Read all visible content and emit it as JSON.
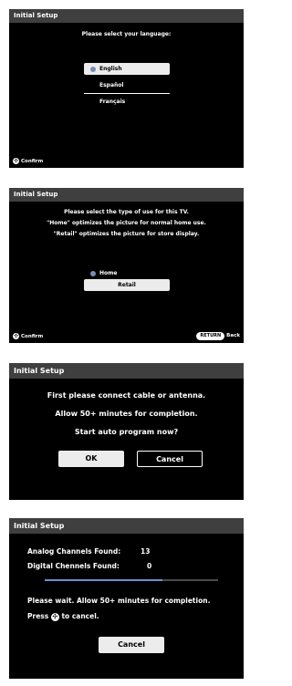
{
  "screen1": {
    "title": "Initial Setup",
    "prompt": "Please select your language:",
    "options": [
      {
        "label": "English",
        "selected": true
      },
      {
        "label": "Español",
        "selected": false
      },
      {
        "label": "Français",
        "selected": false
      }
    ],
    "confirm_label": "Confirm"
  },
  "screen2": {
    "title": "Initial Setup",
    "lines": [
      "Please select the type of use for this TV.",
      "\"Home\" optimizes the picture for normal home use.",
      "\"Retail\" optimizes the picture for store display."
    ],
    "options": [
      {
        "label": "Home",
        "selected": false
      },
      {
        "label": "Retail",
        "selected": true
      }
    ],
    "confirm_label": "Confirm",
    "return_key": "RETURN",
    "back_label": "Back"
  },
  "screen3": {
    "title": "Initial Setup",
    "lines": [
      "First please connect cable or antenna.",
      "Allow 50+ minutes for completion.",
      "Start auto program now?"
    ],
    "ok_label": "OK",
    "cancel_label": "Cancel"
  },
  "screen4": {
    "title": "Initial Setup",
    "analog_label": "Analog Channels Found:",
    "analog_value": "13",
    "digital_label": "Digital Chennels Found:",
    "digital_value": "0",
    "progress": 0.68,
    "wait_text": "Please wait. Allow 50+ minutes for completion.",
    "press_text": "Press",
    "cancel_hint": "to cancel.",
    "cancel_label": "Cancel"
  }
}
